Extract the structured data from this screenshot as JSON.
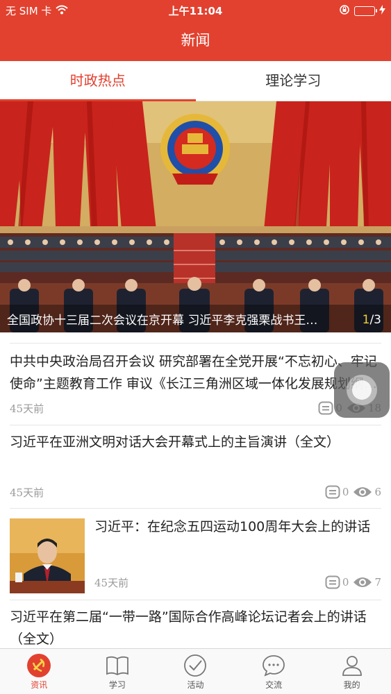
{
  "status_bar": {
    "carrier": "无 SIM 卡",
    "time": "上午11:04"
  },
  "nav": {
    "title": "新闻"
  },
  "tabs": [
    {
      "label": "时政热点",
      "active": true
    },
    {
      "label": "理论学习",
      "active": false
    }
  ],
  "banner": {
    "caption": "全国政协十三届二次会议在京开幕 习近平李克强栗战书王沪宁赵乐际韩正王岐山到会祝贺",
    "page_current": "1",
    "page_total": "/3"
  },
  "news": [
    {
      "title": "中共中央政治局召开会议 研究部署在全党开展“不忘初心、牢记使命”主题教育工作 审议《长江三角洲区域一体化发展规划纲要》",
      "time": "45天前",
      "comments": "0",
      "views": "18"
    },
    {
      "title": "习近平在亚洲文明对话大会开幕式上的主旨演讲（全文）",
      "time": "45天前",
      "comments": "0",
      "views": "6"
    },
    {
      "title": "习近平：在纪念五四运动100周年大会上的讲话",
      "time": "45天前",
      "comments": "0",
      "views": "7"
    },
    {
      "title": "习近平在第二届“一带一路”国际合作高峰论坛记者会上的讲话 （全文）"
    }
  ],
  "tabbar": [
    {
      "label": "资讯",
      "icon": "party-emblem-icon",
      "active": true
    },
    {
      "label": "学习",
      "icon": "book-icon",
      "active": false
    },
    {
      "label": "活动",
      "icon": "check-circle-icon",
      "active": false
    },
    {
      "label": "交流",
      "icon": "chat-bubble-icon",
      "active": false
    },
    {
      "label": "我的",
      "icon": "person-icon",
      "active": false
    }
  ],
  "colors": {
    "brand_red": "#e2412f",
    "pager_highlight": "#f0d034",
    "battery_green": "#4cd964",
    "meta_gray": "#9a9a9a"
  }
}
